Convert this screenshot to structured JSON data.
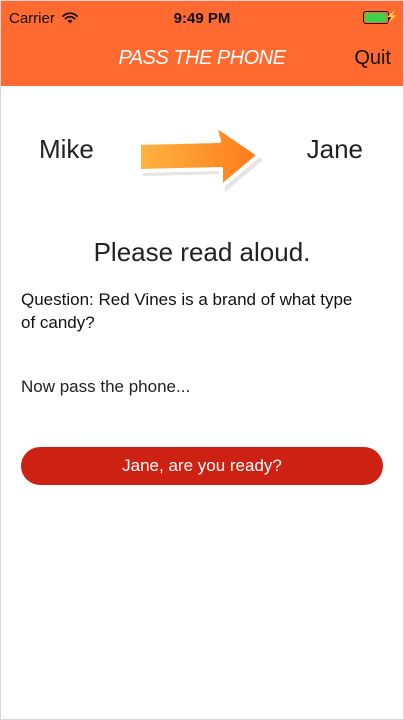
{
  "status_bar": {
    "carrier": "Carrier",
    "time": "9:49 PM",
    "battery_level": 0.95
  },
  "nav": {
    "logo_text": "PASS THE PHONE",
    "quit_label": "Quit"
  },
  "players": {
    "from": "Mike",
    "to": "Jane"
  },
  "content": {
    "instruction": "Please read aloud.",
    "question": "Question: Red Vines is a brand of what type of candy?",
    "pass_note": "Now pass the phone...",
    "ready_button": "Jane, are you ready?"
  },
  "colors": {
    "header": "#ff6a30",
    "button": "#cd2114",
    "arrow": "#ff8a1e"
  },
  "icons": {
    "wifi": "wifi-icon",
    "charging": "bolt-icon",
    "arrow": "arrow-right-icon"
  }
}
